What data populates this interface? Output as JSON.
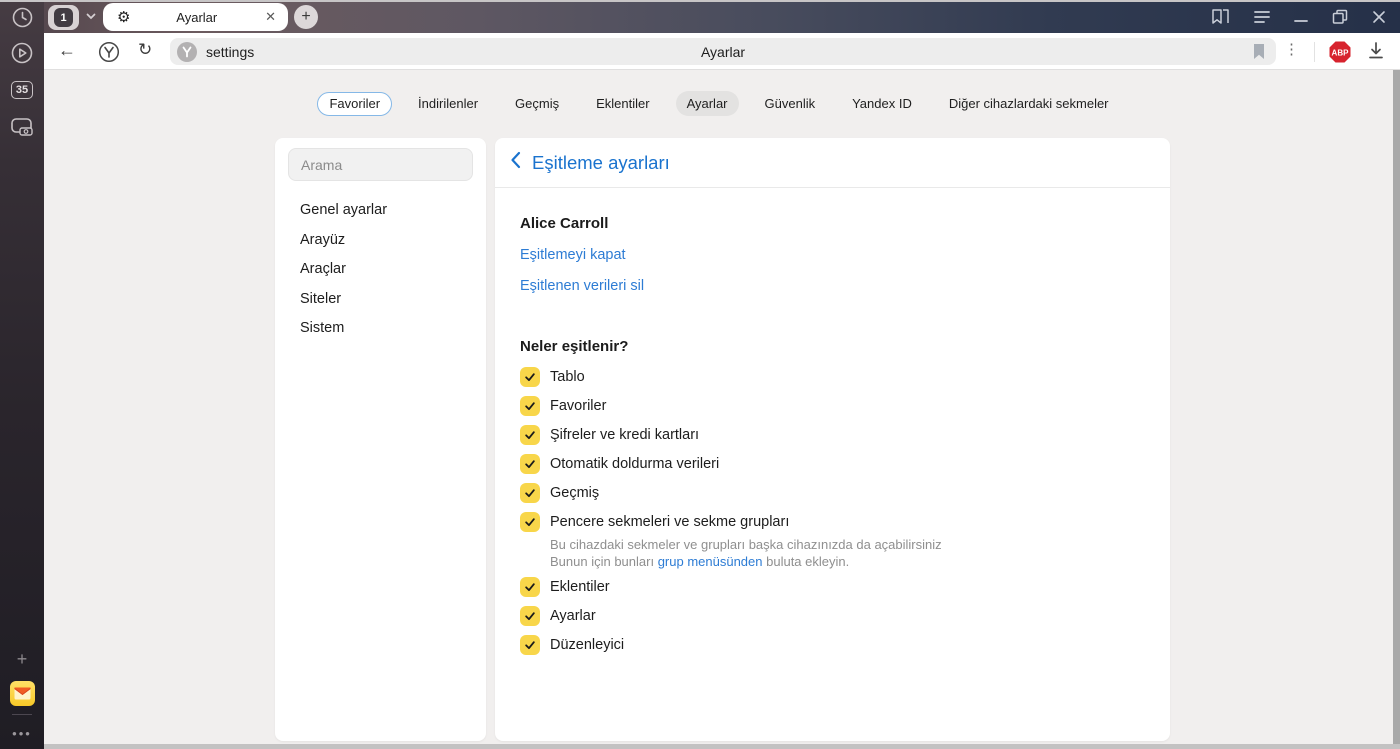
{
  "titlebar": {
    "tab_counter": "1",
    "tab_title": "Ayarlar",
    "close_tab": "✕",
    "new_tab": "+"
  },
  "rail": {
    "tab_count_badge": "35"
  },
  "toolbar": {
    "back": "←",
    "reload": "↻",
    "url_text": "settings",
    "page_title": "Ayarlar",
    "menu_dots": "⋮",
    "adblock_label": "ABP"
  },
  "nav": {
    "items": [
      "Favoriler",
      "İndirilenler",
      "Geçmiş",
      "Eklentiler",
      "Ayarlar",
      "Güvenlik",
      "Yandex ID",
      "Diğer cihazlardaki sekmeler"
    ]
  },
  "settings_nav": {
    "search_placeholder": "Arama",
    "items": [
      "Genel ayarlar",
      "Arayüz",
      "Araçlar",
      "Siteler",
      "Sistem"
    ]
  },
  "sync": {
    "back_chevron": "‹",
    "title": "Eşitleme ayarları",
    "account": "Alice Carroll",
    "link_disable": "Eşitlemeyi kapat",
    "link_delete": "Eşitlenen verileri sil",
    "section": "Neler eşitlenir?",
    "items": [
      {
        "label": "Tablo",
        "checked": true
      },
      {
        "label": "Favoriler",
        "checked": true
      },
      {
        "label": "Şifreler ve kredi kartları",
        "checked": true
      },
      {
        "label": "Otomatik doldurma verileri",
        "checked": true
      },
      {
        "label": "Geçmiş",
        "checked": true
      },
      {
        "label": "Pencere sekmeleri ve sekme grupları",
        "checked": true,
        "note1": "Bu cihazdaki sekmeler ve grupları başka cihazınızda da açabilirsiniz",
        "note2_before": "Bunun için bunları ",
        "note2_link": "grup menüsünden",
        "note2_after": " buluta ekleyin."
      },
      {
        "label": "Eklentiler",
        "checked": true
      },
      {
        "label": "Ayarlar",
        "checked": true
      },
      {
        "label": "Düzenleyici",
        "checked": true
      }
    ]
  },
  "colors": {
    "accent_blue": "#1a73ce",
    "link_blue": "#2d7cd4",
    "checkbox_yellow": "#f8d64a",
    "adblock_red": "#d7232e",
    "titlebar_left": "#6c5b5f",
    "titlebar_right": "#253048"
  }
}
